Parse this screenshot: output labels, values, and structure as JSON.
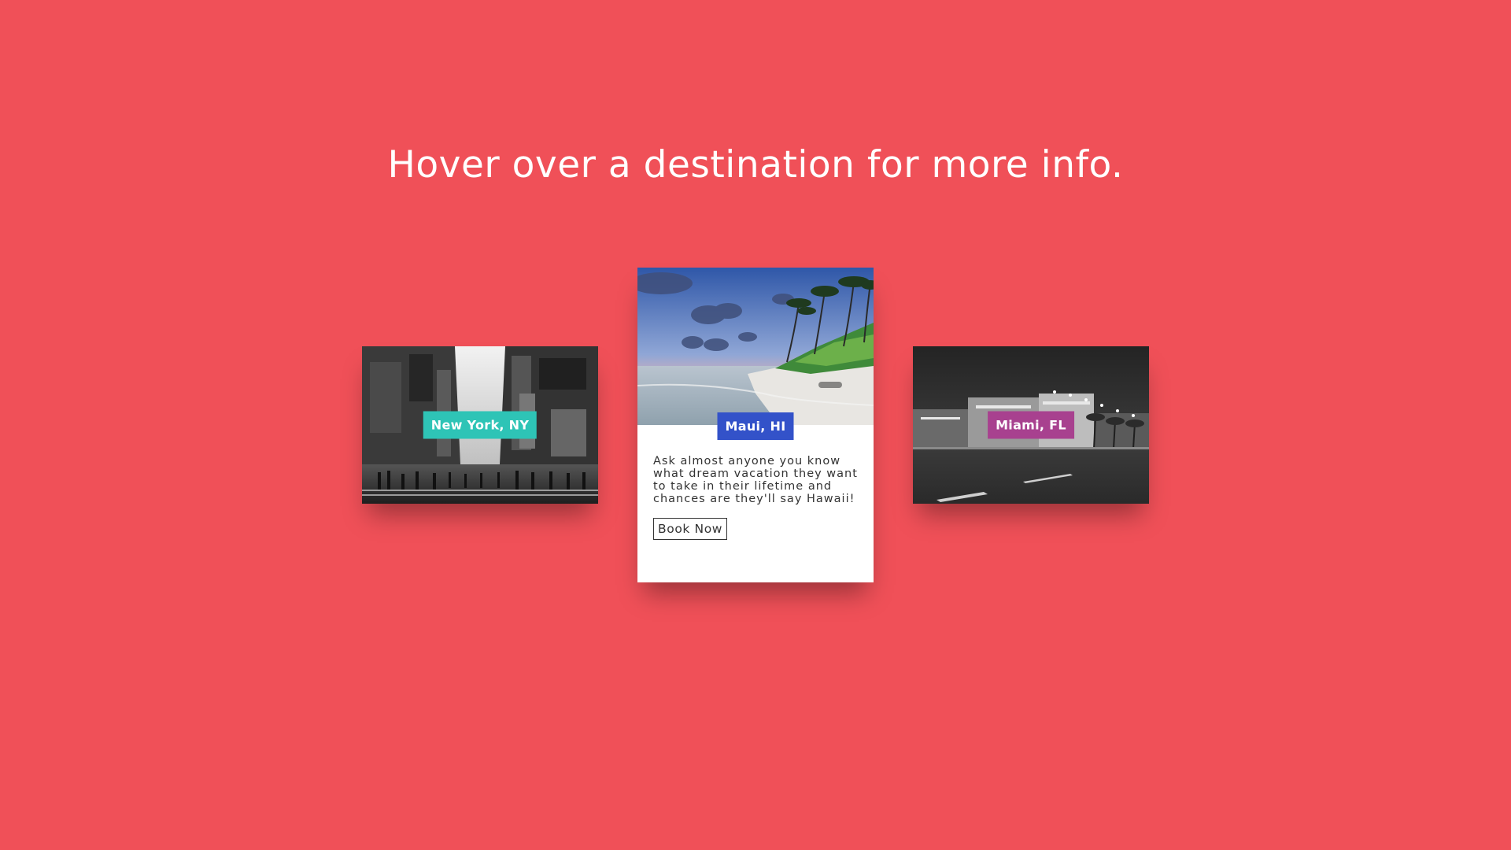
{
  "page": {
    "heading": "Hover over a destination for more info.",
    "background": "#f05058"
  },
  "destinations": [
    {
      "name": "New York, NY",
      "tag_color": "#2ec4b6",
      "image": "city-street-bw"
    },
    {
      "name": "Maui, HI",
      "tag_color": "#3352c9",
      "image": "tropical-beach",
      "description": "Ask almost anyone you know what dream vacation they want to take in their lifetime and chances are they'll say Hawaii!",
      "button_label": "Book Now"
    },
    {
      "name": "Miami, FL",
      "tag_color": "#a8418f",
      "image": "night-street-bw"
    }
  ]
}
